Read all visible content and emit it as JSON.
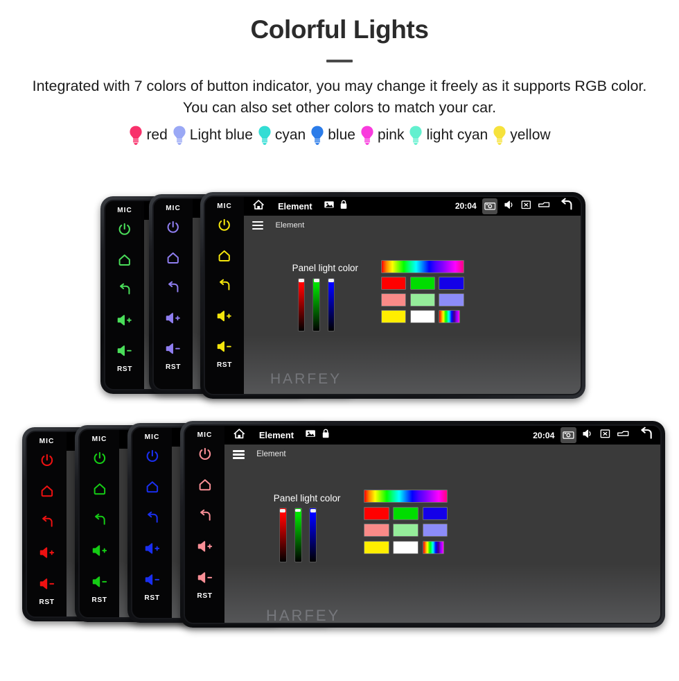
{
  "hero": {
    "title": "Colorful Lights",
    "description": "Integrated with 7 colors of button indicator, you may change it freely as it supports RGB color. You can also set other colors to match your car."
  },
  "legend": {
    "items": [
      {
        "label": "red",
        "color": "#f8316b",
        "icon": "bulb-icon"
      },
      {
        "label": "Light blue",
        "color": "#9aa8f5",
        "icon": "bulb-icon"
      },
      {
        "label": "cyan",
        "color": "#33ddd4",
        "icon": "bulb-icon"
      },
      {
        "label": "blue",
        "color": "#2b7ce9",
        "icon": "bulb-icon"
      },
      {
        "label": "pink",
        "color": "#f93bdd",
        "icon": "bulb-icon"
      },
      {
        "label": "light cyan",
        "color": "#63f0cf",
        "icon": "bulb-icon"
      },
      {
        "label": "yellow",
        "color": "#f6e23c",
        "icon": "bulb-icon"
      }
    ]
  },
  "device_ui": {
    "mic_label": "MIC",
    "rst_label": "RST",
    "buttons": [
      {
        "name": "power-button",
        "icon": "power-icon"
      },
      {
        "name": "home-button",
        "icon": "home-icon"
      },
      {
        "name": "back-button",
        "icon": "back-arrow-icon"
      },
      {
        "name": "volume-up-button",
        "icon": "volume-up-icon"
      },
      {
        "name": "volume-down-button",
        "icon": "volume-down-icon"
      }
    ],
    "statusbar": {
      "home_icon": "home-icon",
      "title": "Element",
      "image_icon": "image-icon",
      "lock_icon": "lock-icon",
      "time": "20:04",
      "camera_icon": "camera-icon",
      "mute_icon": "volume-mute-icon",
      "close_icon": "close-box-icon",
      "window_icon": "window-icon",
      "back_icon": "back-arrow-icon"
    },
    "appbar": {
      "menu_icon": "hamburger-menu-icon",
      "title": "Element"
    },
    "panel": {
      "label": "Panel light color",
      "sliders": [
        {
          "name": "red-slider",
          "color": "#ff0000",
          "value": 92
        },
        {
          "name": "green-slider",
          "color": "#00e000",
          "value": 94
        },
        {
          "name": "blue-slider",
          "color": "#0000ff",
          "value": 93
        }
      ],
      "hue_bar": "hue-gradient-bar",
      "swatches": [
        [
          {
            "name": "swatch-red",
            "color": "#ff0000"
          },
          {
            "name": "swatch-green",
            "color": "#00dd00"
          },
          {
            "name": "swatch-blue",
            "color": "#1400e8"
          }
        ],
        [
          {
            "name": "swatch-salmon",
            "color": "#fa8a88"
          },
          {
            "name": "swatch-light-green",
            "color": "#95ec9a"
          },
          {
            "name": "swatch-periwinkle",
            "color": "#8c8cf8"
          }
        ],
        [
          {
            "name": "swatch-yellow",
            "color": "#ffee00"
          },
          {
            "name": "swatch-white",
            "color": "#ffffff"
          },
          {
            "name": "swatch-rainbow",
            "color": "rainbow"
          }
        ]
      ]
    },
    "watermark": "HARFEY"
  },
  "device_groups": [
    {
      "name": "device-stack-top",
      "devices": [
        {
          "name": "device-top-green",
          "button_color": "#4ade5a",
          "front": false
        },
        {
          "name": "device-top-lightblue",
          "button_color": "#8f7ef0",
          "front": false
        },
        {
          "name": "device-top-yellow",
          "button_color": "#f5e60c",
          "front": true
        }
      ]
    },
    {
      "name": "device-stack-bottom",
      "devices": [
        {
          "name": "device-bottom-red",
          "button_color": "#ee1111",
          "front": false
        },
        {
          "name": "device-bottom-green",
          "button_color": "#15cc15",
          "front": false
        },
        {
          "name": "device-bottom-blue",
          "button_color": "#1a2ff0",
          "front": false
        },
        {
          "name": "device-bottom-pink",
          "button_color": "#f98f96",
          "front": true
        }
      ]
    }
  ]
}
